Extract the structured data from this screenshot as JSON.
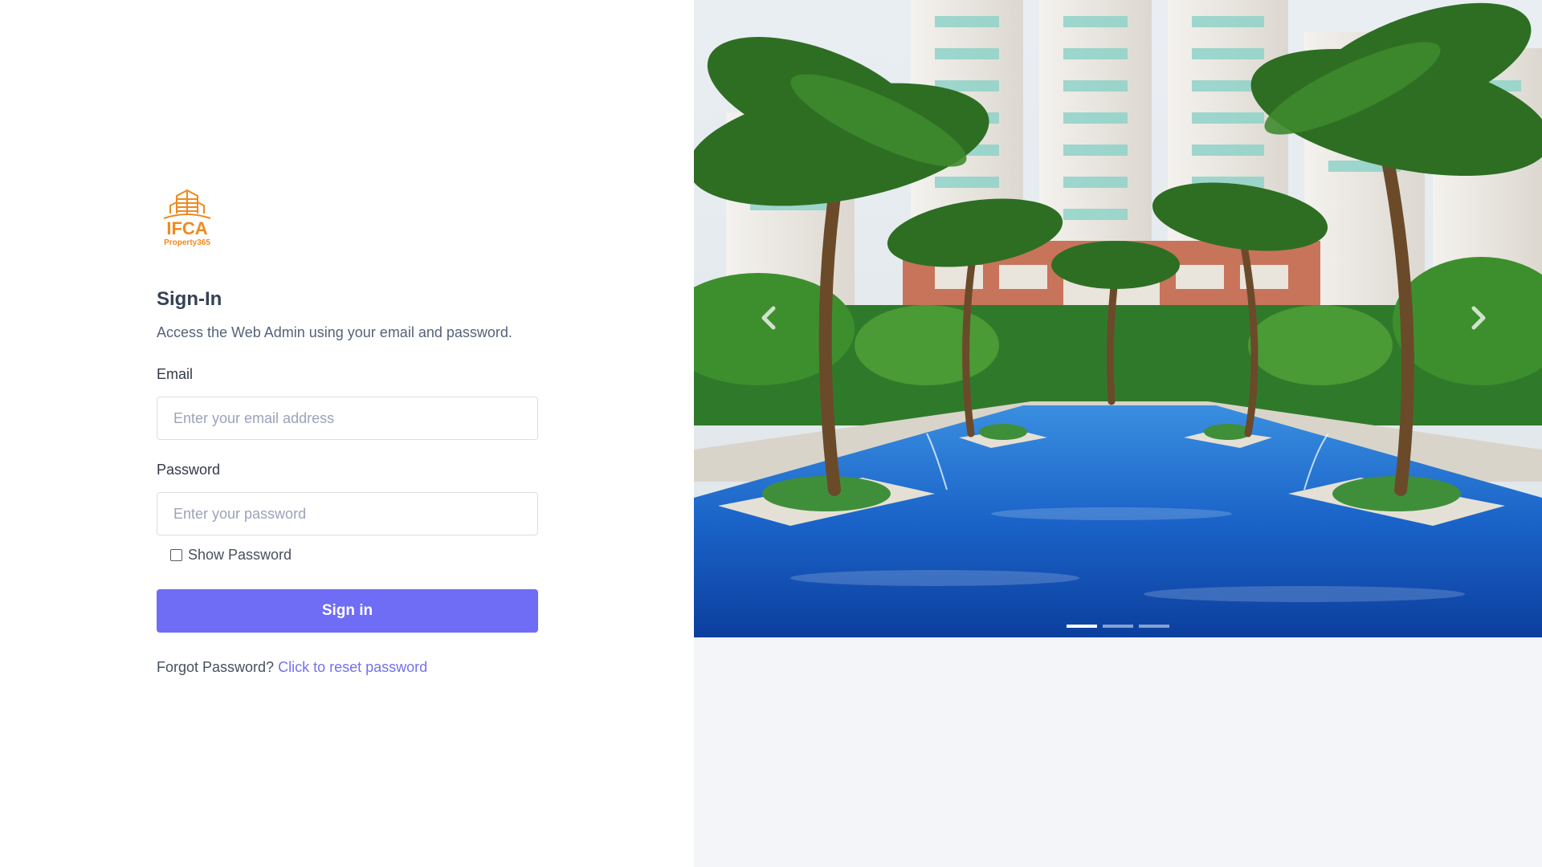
{
  "logo": {
    "brand": "IFCA",
    "tagline": "Property365",
    "brand_color": "#f08a1c"
  },
  "signin": {
    "title": "Sign-In",
    "subtitle": "Access the Web Admin using your email and password.",
    "email": {
      "label": "Email",
      "placeholder": "Enter your email address",
      "value": ""
    },
    "password": {
      "label": "Password",
      "placeholder": "Enter your password",
      "value": ""
    },
    "show_password": {
      "label": "Show Password",
      "checked": false
    },
    "button_label": "Sign in",
    "button_color": "#6f6cf5",
    "forgot_text": "Forgot Password?",
    "reset_link": "Click to reset password"
  },
  "carousel": {
    "prev_icon": "chevron-left-icon",
    "next_icon": "chevron-right-icon",
    "slides": 3,
    "active_slide": 1,
    "image_description": "palm-lined resort pool between high-rise apartment towers"
  }
}
